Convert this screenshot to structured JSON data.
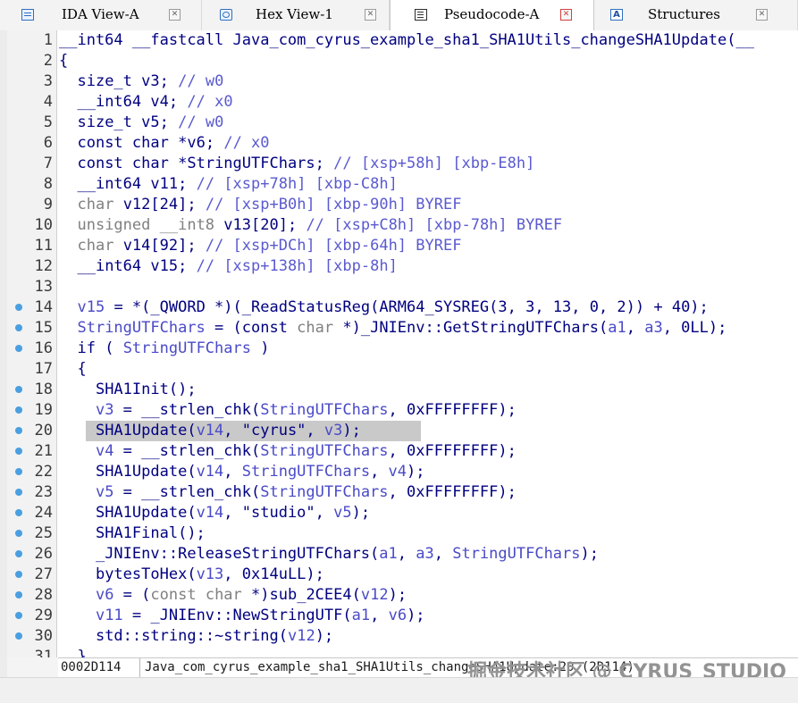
{
  "tabs": [
    {
      "label": "IDA View-A",
      "icon": "ida-view-icon",
      "close": "✕",
      "active": false
    },
    {
      "label": "Hex View-1",
      "icon": "hex-view-icon",
      "close": "✕",
      "active": false
    },
    {
      "label": "Pseudocode-A",
      "icon": "pseudocode-icon",
      "close": "✕",
      "active": true
    },
    {
      "label": "Structures",
      "icon": "structures-icon",
      "icon_text": "A",
      "close": "✕",
      "active": false
    }
  ],
  "code_lines": [
    {
      "n": "1",
      "text": "__int64 __fastcall Java_com_cyrus_example_sha1_SHA1Utils_changeSHA1Update(__",
      "dot": false
    },
    {
      "n": "2",
      "text": "{",
      "dot": false
    },
    {
      "n": "3",
      "text": "  size_t v3; // w0",
      "dot": false
    },
    {
      "n": "4",
      "text": "  __int64 v4; // x0",
      "dot": false
    },
    {
      "n": "5",
      "text": "  size_t v5; // w0",
      "dot": false
    },
    {
      "n": "6",
      "text": "  const char *v6; // x0",
      "dot": false
    },
    {
      "n": "7",
      "text": "  const char *StringUTFChars; // [xsp+58h] [xbp-E8h]",
      "dot": false
    },
    {
      "n": "8",
      "text": "  __int64 v11; // [xsp+78h] [xbp-C8h]",
      "dot": false
    },
    {
      "n": "9",
      "text": "  char v12[24]; // [xsp+B0h] [xbp-90h] BYREF",
      "dot": false
    },
    {
      "n": "10",
      "text": "  unsigned __int8 v13[20]; // [xsp+C8h] [xbp-78h] BYREF",
      "dot": false
    },
    {
      "n": "11",
      "text": "  char v14[92]; // [xsp+DCh] [xbp-64h] BYREF",
      "dot": false
    },
    {
      "n": "12",
      "text": "  __int64 v15; // [xsp+138h] [xbp-8h]",
      "dot": false
    },
    {
      "n": "13",
      "text": "",
      "dot": false
    },
    {
      "n": "14",
      "text": "  v15 = *(_QWORD *)(_ReadStatusReg(ARM64_SYSREG(3, 3, 13, 0, 2)) + 40);",
      "dot": true
    },
    {
      "n": "15",
      "text": "  StringUTFChars = (const char *)_JNIEnv::GetStringUTFChars(a1, a3, 0LL);",
      "dot": true
    },
    {
      "n": "16",
      "text": "  if ( StringUTFChars )",
      "dot": true
    },
    {
      "n": "17",
      "text": "  {",
      "dot": false
    },
    {
      "n": "18",
      "text": "    SHA1Init();",
      "dot": true
    },
    {
      "n": "19",
      "text": "    v3 = __strlen_chk(StringUTFChars, 0xFFFFFFFF);",
      "dot": true
    },
    {
      "n": "20",
      "text": "    SHA1Update(v14, \"cyrus\", v3);",
      "dot": true
    },
    {
      "n": "21",
      "text": "    v4 = __strlen_chk(StringUTFChars, 0xFFFFFFFF);",
      "dot": true
    },
    {
      "n": "22",
      "text": "    SHA1Update(v14, StringUTFChars, v4);",
      "dot": true
    },
    {
      "n": "23",
      "text": "    v5 = __strlen_chk(StringUTFChars, 0xFFFFFFFF);",
      "dot": true
    },
    {
      "n": "24",
      "text": "    SHA1Update(v14, \"studio\", v5);",
      "dot": true
    },
    {
      "n": "25",
      "text": "    SHA1Final();",
      "dot": true
    },
    {
      "n": "26",
      "text": "    _JNIEnv::ReleaseStringUTFChars(a1, a3, StringUTFChars);",
      "dot": true
    },
    {
      "n": "27",
      "text": "    bytesToHex(v13, 0x14uLL);",
      "dot": true
    },
    {
      "n": "28",
      "text": "    v6 = (const char *)sub_2CEE4(v12);",
      "dot": true
    },
    {
      "n": "29",
      "text": "    v11 = _JNIEnv::NewStringUTF(a1, v6);",
      "dot": true
    },
    {
      "n": "30",
      "text": "    std::string::~string(v12);",
      "dot": true
    },
    {
      "n": "31",
      "text": "  }",
      "dot": false
    }
  ],
  "highlighted_line": "20",
  "status": {
    "address": "0002D114",
    "function": "Java_com_cyrus_example_sha1_SHA1Utils_changeSHA1Update:20 (2D114)"
  },
  "watermark": "掘金技术社区 @ CYRUS_STUDIO",
  "colors": {
    "keyword": "#000080",
    "variable": "#4a4ac8",
    "comment": "#5a5ad0",
    "gray": "#808080",
    "highlight": "#c9c9c9",
    "breakpoint_dot": "#4a9fe0"
  }
}
